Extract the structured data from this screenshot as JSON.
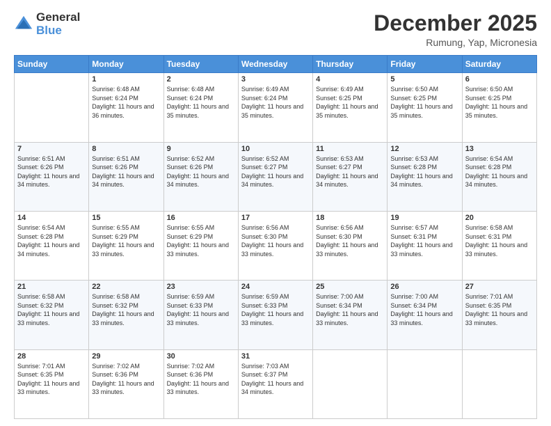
{
  "logo": {
    "text_general": "General",
    "text_blue": "Blue"
  },
  "header": {
    "month": "December 2025",
    "location": "Rumung, Yap, Micronesia"
  },
  "weekdays": [
    "Sunday",
    "Monday",
    "Tuesday",
    "Wednesday",
    "Thursday",
    "Friday",
    "Saturday"
  ],
  "weeks": [
    [
      {
        "day": "",
        "sunrise": "",
        "sunset": "",
        "daylight": ""
      },
      {
        "day": "1",
        "sunrise": "Sunrise: 6:48 AM",
        "sunset": "Sunset: 6:24 PM",
        "daylight": "Daylight: 11 hours and 36 minutes."
      },
      {
        "day": "2",
        "sunrise": "Sunrise: 6:48 AM",
        "sunset": "Sunset: 6:24 PM",
        "daylight": "Daylight: 11 hours and 35 minutes."
      },
      {
        "day": "3",
        "sunrise": "Sunrise: 6:49 AM",
        "sunset": "Sunset: 6:24 PM",
        "daylight": "Daylight: 11 hours and 35 minutes."
      },
      {
        "day": "4",
        "sunrise": "Sunrise: 6:49 AM",
        "sunset": "Sunset: 6:25 PM",
        "daylight": "Daylight: 11 hours and 35 minutes."
      },
      {
        "day": "5",
        "sunrise": "Sunrise: 6:50 AM",
        "sunset": "Sunset: 6:25 PM",
        "daylight": "Daylight: 11 hours and 35 minutes."
      },
      {
        "day": "6",
        "sunrise": "Sunrise: 6:50 AM",
        "sunset": "Sunset: 6:25 PM",
        "daylight": "Daylight: 11 hours and 35 minutes."
      }
    ],
    [
      {
        "day": "7",
        "sunrise": "Sunrise: 6:51 AM",
        "sunset": "Sunset: 6:26 PM",
        "daylight": "Daylight: 11 hours and 34 minutes."
      },
      {
        "day": "8",
        "sunrise": "Sunrise: 6:51 AM",
        "sunset": "Sunset: 6:26 PM",
        "daylight": "Daylight: 11 hours and 34 minutes."
      },
      {
        "day": "9",
        "sunrise": "Sunrise: 6:52 AM",
        "sunset": "Sunset: 6:26 PM",
        "daylight": "Daylight: 11 hours and 34 minutes."
      },
      {
        "day": "10",
        "sunrise": "Sunrise: 6:52 AM",
        "sunset": "Sunset: 6:27 PM",
        "daylight": "Daylight: 11 hours and 34 minutes."
      },
      {
        "day": "11",
        "sunrise": "Sunrise: 6:53 AM",
        "sunset": "Sunset: 6:27 PM",
        "daylight": "Daylight: 11 hours and 34 minutes."
      },
      {
        "day": "12",
        "sunrise": "Sunrise: 6:53 AM",
        "sunset": "Sunset: 6:28 PM",
        "daylight": "Daylight: 11 hours and 34 minutes."
      },
      {
        "day": "13",
        "sunrise": "Sunrise: 6:54 AM",
        "sunset": "Sunset: 6:28 PM",
        "daylight": "Daylight: 11 hours and 34 minutes."
      }
    ],
    [
      {
        "day": "14",
        "sunrise": "Sunrise: 6:54 AM",
        "sunset": "Sunset: 6:28 PM",
        "daylight": "Daylight: 11 hours and 34 minutes."
      },
      {
        "day": "15",
        "sunrise": "Sunrise: 6:55 AM",
        "sunset": "Sunset: 6:29 PM",
        "daylight": "Daylight: 11 hours and 33 minutes."
      },
      {
        "day": "16",
        "sunrise": "Sunrise: 6:55 AM",
        "sunset": "Sunset: 6:29 PM",
        "daylight": "Daylight: 11 hours and 33 minutes."
      },
      {
        "day": "17",
        "sunrise": "Sunrise: 6:56 AM",
        "sunset": "Sunset: 6:30 PM",
        "daylight": "Daylight: 11 hours and 33 minutes."
      },
      {
        "day": "18",
        "sunrise": "Sunrise: 6:56 AM",
        "sunset": "Sunset: 6:30 PM",
        "daylight": "Daylight: 11 hours and 33 minutes."
      },
      {
        "day": "19",
        "sunrise": "Sunrise: 6:57 AM",
        "sunset": "Sunset: 6:31 PM",
        "daylight": "Daylight: 11 hours and 33 minutes."
      },
      {
        "day": "20",
        "sunrise": "Sunrise: 6:58 AM",
        "sunset": "Sunset: 6:31 PM",
        "daylight": "Daylight: 11 hours and 33 minutes."
      }
    ],
    [
      {
        "day": "21",
        "sunrise": "Sunrise: 6:58 AM",
        "sunset": "Sunset: 6:32 PM",
        "daylight": "Daylight: 11 hours and 33 minutes."
      },
      {
        "day": "22",
        "sunrise": "Sunrise: 6:58 AM",
        "sunset": "Sunset: 6:32 PM",
        "daylight": "Daylight: 11 hours and 33 minutes."
      },
      {
        "day": "23",
        "sunrise": "Sunrise: 6:59 AM",
        "sunset": "Sunset: 6:33 PM",
        "daylight": "Daylight: 11 hours and 33 minutes."
      },
      {
        "day": "24",
        "sunrise": "Sunrise: 6:59 AM",
        "sunset": "Sunset: 6:33 PM",
        "daylight": "Daylight: 11 hours and 33 minutes."
      },
      {
        "day": "25",
        "sunrise": "Sunrise: 7:00 AM",
        "sunset": "Sunset: 6:34 PM",
        "daylight": "Daylight: 11 hours and 33 minutes."
      },
      {
        "day": "26",
        "sunrise": "Sunrise: 7:00 AM",
        "sunset": "Sunset: 6:34 PM",
        "daylight": "Daylight: 11 hours and 33 minutes."
      },
      {
        "day": "27",
        "sunrise": "Sunrise: 7:01 AM",
        "sunset": "Sunset: 6:35 PM",
        "daylight": "Daylight: 11 hours and 33 minutes."
      }
    ],
    [
      {
        "day": "28",
        "sunrise": "Sunrise: 7:01 AM",
        "sunset": "Sunset: 6:35 PM",
        "daylight": "Daylight: 11 hours and 33 minutes."
      },
      {
        "day": "29",
        "sunrise": "Sunrise: 7:02 AM",
        "sunset": "Sunset: 6:36 PM",
        "daylight": "Daylight: 11 hours and 33 minutes."
      },
      {
        "day": "30",
        "sunrise": "Sunrise: 7:02 AM",
        "sunset": "Sunset: 6:36 PM",
        "daylight": "Daylight: 11 hours and 33 minutes."
      },
      {
        "day": "31",
        "sunrise": "Sunrise: 7:03 AM",
        "sunset": "Sunset: 6:37 PM",
        "daylight": "Daylight: 11 hours and 34 minutes."
      },
      {
        "day": "",
        "sunrise": "",
        "sunset": "",
        "daylight": ""
      },
      {
        "day": "",
        "sunrise": "",
        "sunset": "",
        "daylight": ""
      },
      {
        "day": "",
        "sunrise": "",
        "sunset": "",
        "daylight": ""
      }
    ]
  ]
}
